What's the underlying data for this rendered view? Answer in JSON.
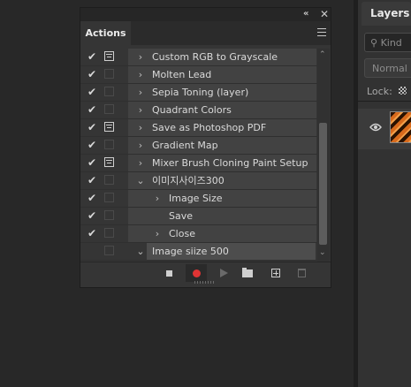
{
  "right_panel": {
    "tab_label": "Layers",
    "kind_label": "Kind",
    "kind_icon": "search-icon",
    "blend_mode": "Normal",
    "lock_label": "Lock:",
    "lock_icon": "checkerboard-lock-icon",
    "visibility_icon": "eye-icon"
  },
  "actions_panel": {
    "collapse_glyph": "«",
    "close_glyph": "✕",
    "tab_label": "Actions",
    "menu_icon": "panel-menu-icon",
    "items": [
      {
        "label": "Custom RGB to Grayscale",
        "checked": true,
        "dialog": true,
        "indent": 0,
        "expand": "›"
      },
      {
        "label": "Molten Lead",
        "checked": true,
        "dialog": false,
        "indent": 0,
        "expand": "›"
      },
      {
        "label": "Sepia Toning (layer)",
        "checked": true,
        "dialog": false,
        "indent": 0,
        "expand": "›"
      },
      {
        "label": "Quadrant Colors",
        "checked": true,
        "dialog": false,
        "indent": 0,
        "expand": "›"
      },
      {
        "label": "Save as Photoshop PDF",
        "checked": true,
        "dialog": true,
        "indent": 0,
        "expand": "›"
      },
      {
        "label": "Gradient Map",
        "checked": true,
        "dialog": false,
        "indent": 0,
        "expand": "›"
      },
      {
        "label": "Mixer Brush Cloning Paint Setup",
        "checked": true,
        "dialog": true,
        "indent": 0,
        "expand": "›"
      },
      {
        "label": "이미지사이즈300",
        "checked": true,
        "dialog": false,
        "indent": 0,
        "expand": "⌄"
      },
      {
        "label": "Image Size",
        "checked": true,
        "dialog": false,
        "indent": 1,
        "expand": "›"
      },
      {
        "label": "Save",
        "checked": true,
        "dialog": false,
        "indent": 1,
        "expand": ""
      },
      {
        "label": "Close",
        "checked": true,
        "dialog": false,
        "indent": 1,
        "expand": "›"
      },
      {
        "label": "Image siize 500",
        "checked": false,
        "dialog": false,
        "indent": 0,
        "expand": "⌄",
        "selected": true
      }
    ],
    "footer_buttons": [
      {
        "name": "stop-recording-button",
        "icon": "stop-icon"
      },
      {
        "name": "record-button",
        "icon": "record-icon",
        "color": "#e03434"
      },
      {
        "name": "play-selection-button",
        "icon": "play-icon"
      },
      {
        "name": "create-new-set-button",
        "icon": "folder-icon"
      },
      {
        "name": "create-new-action-button",
        "icon": "add-icon"
      },
      {
        "name": "delete-button",
        "icon": "trash-icon"
      }
    ],
    "scroll_up_glyph": "⌃",
    "scroll_down_glyph": "⌄",
    "checkmark_glyph": "✔"
  }
}
